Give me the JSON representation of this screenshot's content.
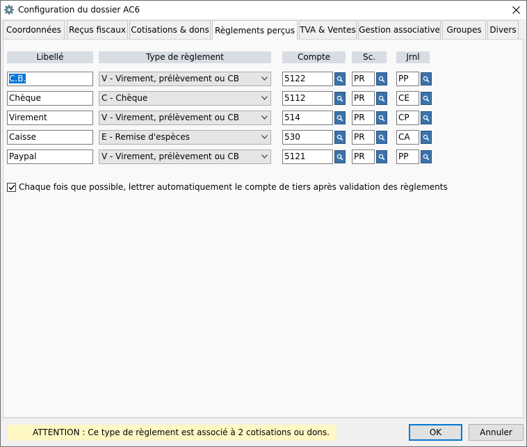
{
  "window": {
    "title": "Configuration du dossier AC6"
  },
  "tabs": [
    {
      "label": "Coordonnées",
      "active": false
    },
    {
      "label": "Reçus fiscaux",
      "active": false
    },
    {
      "label": "Cotisations & dons",
      "active": false
    },
    {
      "label": "Règlements perçus",
      "active": true
    },
    {
      "label": "TVA & Ventes",
      "active": false
    },
    {
      "label": "Gestion associative",
      "active": false
    },
    {
      "label": "Groupes",
      "active": false
    },
    {
      "label": "Divers",
      "active": false
    }
  ],
  "columns": {
    "libelle": "Libellé",
    "type": "Type de règlement",
    "compte": "Compte",
    "sc": "Sc.",
    "jrnl": "Jrnl"
  },
  "rows": [
    {
      "libelle": "C.B.",
      "type": "V - Virement, prélèvement ou CB",
      "compte": "5122",
      "sc": "PR",
      "jrnl": "PP"
    },
    {
      "libelle": "Chèque",
      "type": "C - Chèque",
      "compte": "5112",
      "sc": "PR",
      "jrnl": "CE"
    },
    {
      "libelle": "Virement",
      "type": "V - Virement, prélèvement ou CB",
      "compte": "514",
      "sc": "PR",
      "jrnl": "CP"
    },
    {
      "libelle": "Caisse",
      "type": "E - Remise d'espèces",
      "compte": "530",
      "sc": "PR",
      "jrnl": "CA"
    },
    {
      "libelle": "Paypal",
      "type": "V - Virement, prélèvement ou CB",
      "compte": "5121",
      "sc": "PR",
      "jrnl": "PP"
    }
  ],
  "auto_lettrage": {
    "checked": true,
    "label": "Chaque fois que possible, lettrer automatiquement le compte de tiers après validation des règlements"
  },
  "footer": {
    "warning": "ATTENTION : Ce type de règlement  est associé à 2 cotisations ou dons.",
    "ok_label": "OK",
    "cancel_label": "Annuler"
  },
  "colors": {
    "selection": "#0078d7",
    "lookup_button": "#3c72a8",
    "warning_bg": "#fff7c4",
    "header_bg": "#d8dde4"
  },
  "icons": {
    "app": "gear-icon",
    "close": "close-icon",
    "lookup": "magnifier-icon",
    "dropdown": "chevron-down-icon",
    "check": "checkmark-icon"
  }
}
